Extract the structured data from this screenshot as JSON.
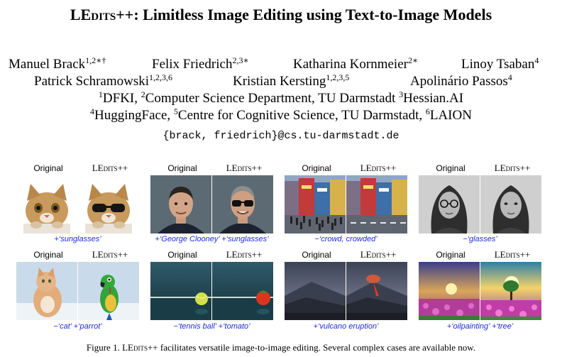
{
  "title": {
    "pre": "LE",
    "sc": "dits",
    "post": "++: Limitless Image Editing using Text-to-Image Models"
  },
  "authors": [
    {
      "name": "Manuel Brack",
      "sup": "1,2∗†"
    },
    {
      "name": "Felix Friedrich",
      "sup": "2,3∗"
    },
    {
      "name": "Katharina Kornmeier",
      "sup": "2∗"
    },
    {
      "name": "Linoy Tsaban",
      "sup": "4"
    },
    {
      "name": "Patrick Schramowski",
      "sup": "1,2,3,6"
    },
    {
      "name": "Kristian Kersting",
      "sup": "1,2,3,5"
    },
    {
      "name": "Apolinário Passos",
      "sup": "4"
    }
  ],
  "affiliations": [
    {
      "sup": "1",
      "text": "DFKI, "
    },
    {
      "sup": "2",
      "text": "Computer Science Department, TU Darmstadt "
    },
    {
      "sup": "3",
      "text": "Hessian.AI"
    },
    {
      "sup": "4",
      "text": "HuggingFace, "
    },
    {
      "sup": "5",
      "text": "Centre for Cognitive Science, TU Darmstadt, "
    },
    {
      "sup": "6",
      "text": "LAION"
    }
  ],
  "email": "{brack, friedrich}@cs.tu-darmstadt.de",
  "labels": {
    "original": "Original",
    "pre": "LE",
    "sc": "dits",
    "post": "++"
  },
  "examples": [
    {
      "caption": "+‘sunglasses’"
    },
    {
      "caption": "+‘George Clooney’ +‘sunglasses’"
    },
    {
      "caption": "−‘crowd, crowded’"
    },
    {
      "caption": "−‘glasses’"
    },
    {
      "caption": "−‘cat’ +‘parrot’"
    },
    {
      "caption": "−‘tennis ball’ +‘tomato’"
    },
    {
      "caption": "+‘vulcano eruption’"
    },
    {
      "caption": "+‘oilpainting’ +‘tree’"
    }
  ],
  "figure_caption": {
    "prefix": "Figure 1. ",
    "pre": "LE",
    "sc": "dits",
    "post": "++ facilitates versatile image-to-image editing. Several complex cases are available now."
  },
  "colors": {
    "caption_blue": "#1f2bd6"
  }
}
